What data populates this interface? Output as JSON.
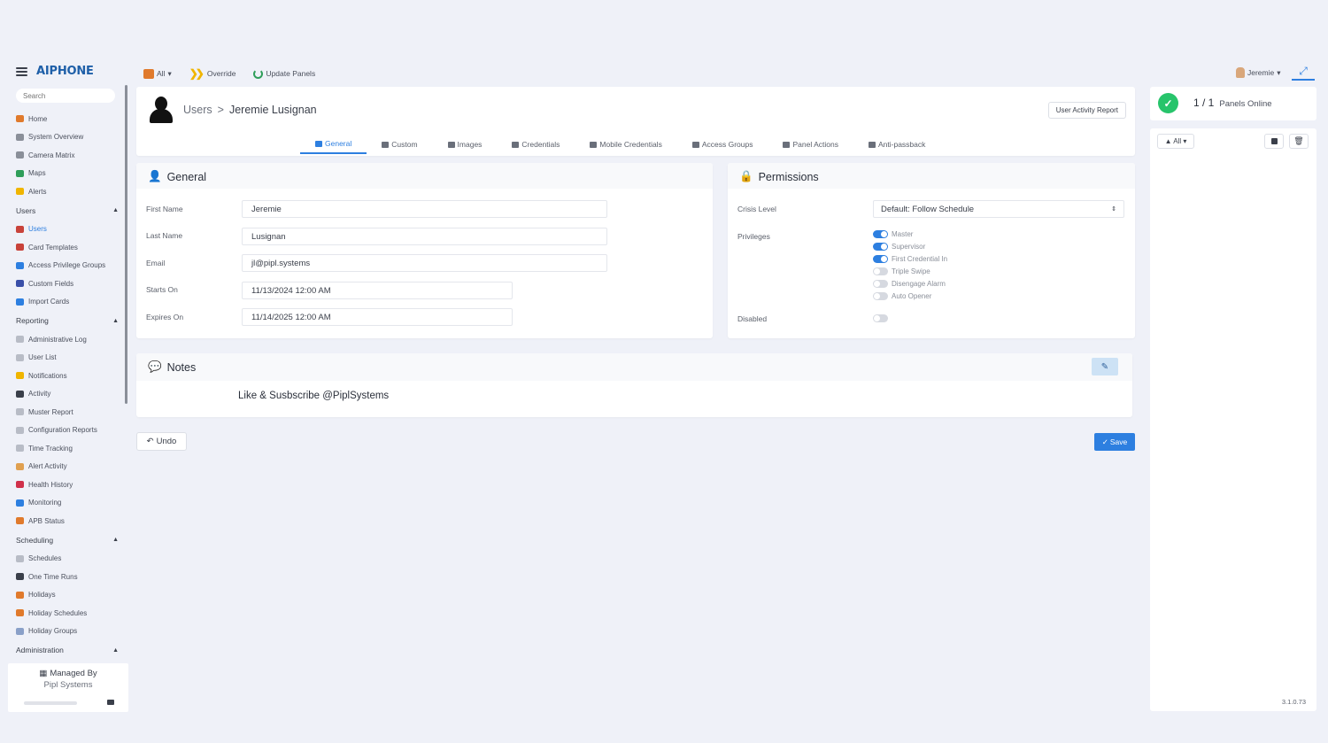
{
  "sidebar": {
    "logo": "AIPHONE",
    "search_placeholder": "Search",
    "items": [
      {
        "label": "Home",
        "color": "#e07a2c"
      },
      {
        "label": "System Overview",
        "color": "#8a8f99"
      },
      {
        "label": "Camera Matrix",
        "color": "#8a8f99"
      },
      {
        "label": "Maps",
        "color": "#2f9e5a"
      },
      {
        "label": "Alerts",
        "color": "#f0b500"
      }
    ],
    "sections": {
      "users": {
        "label": "Users",
        "items": [
          {
            "label": "Users",
            "color": "#c8423a",
            "active": true
          },
          {
            "label": "Card Templates",
            "color": "#c8423a"
          },
          {
            "label": "Access Privilege Groups",
            "color": "#2d7fe0"
          },
          {
            "label": "Custom Fields",
            "color": "#3a4fa8"
          },
          {
            "label": "Import Cards",
            "color": "#2d7fe0"
          }
        ]
      },
      "reporting": {
        "label": "Reporting",
        "items": [
          {
            "label": "Administrative Log",
            "color": "#b8bcc6"
          },
          {
            "label": "User List",
            "color": "#b8bcc6"
          },
          {
            "label": "Notifications",
            "color": "#f0b500"
          },
          {
            "label": "Activity",
            "color": "#3a3f4a"
          },
          {
            "label": "Muster Report",
            "color": "#b8bcc6"
          },
          {
            "label": "Configuration Reports",
            "color": "#b8bcc6"
          },
          {
            "label": "Time Tracking",
            "color": "#b8bcc6"
          },
          {
            "label": "Alert Activity",
            "color": "#e0a050"
          },
          {
            "label": "Health History",
            "color": "#d0304a"
          },
          {
            "label": "Monitoring",
            "color": "#2d7fe0"
          },
          {
            "label": "APB Status",
            "color": "#e07a2c"
          }
        ]
      },
      "scheduling": {
        "label": "Scheduling",
        "items": [
          {
            "label": "Schedules",
            "color": "#b8bcc6"
          },
          {
            "label": "One Time Runs",
            "color": "#3a3f4a"
          },
          {
            "label": "Holidays",
            "color": "#e07a2c"
          },
          {
            "label": "Holiday Schedules",
            "color": "#e07a2c"
          },
          {
            "label": "Holiday Groups",
            "color": "#8aa0c8"
          }
        ]
      },
      "administration": {
        "label": "Administration"
      }
    },
    "managed_by_label": "Managed By",
    "managed_by_name": "Pipl Systems"
  },
  "toolbar": {
    "all_label": "All",
    "override_label": "Override",
    "update_label": "Update Panels",
    "user_label": "Jeremie"
  },
  "header": {
    "breadcrumb_root": "Users",
    "breadcrumb_sep": ">",
    "breadcrumb_current": "Jeremie Lusignan",
    "report_button": "User Activity Report"
  },
  "tabs": [
    {
      "label": "General",
      "active": true
    },
    {
      "label": "Custom"
    },
    {
      "label": "Images"
    },
    {
      "label": "Credentials"
    },
    {
      "label": "Mobile Credentials"
    },
    {
      "label": "Access Groups"
    },
    {
      "label": "Panel Actions"
    },
    {
      "label": "Anti-passback"
    }
  ],
  "general": {
    "title": "General",
    "fields": [
      {
        "label": "First Name",
        "value": "Jeremie"
      },
      {
        "label": "Last Name",
        "value": "Lusignan"
      },
      {
        "label": "Email",
        "value": "jl@pipl.systems"
      },
      {
        "label": "Starts On",
        "value": "11/13/2024 12:00 AM"
      },
      {
        "label": "Expires On",
        "value": "11/14/2025 12:00 AM"
      }
    ]
  },
  "permissions": {
    "title": "Permissions",
    "crisis_label": "Crisis Level",
    "crisis_value": "Default: Follow Schedule",
    "privileges_label": "Privileges",
    "privileges": [
      {
        "label": "Master",
        "on": true
      },
      {
        "label": "Supervisor",
        "on": true
      },
      {
        "label": "First Credential In",
        "on": true
      },
      {
        "label": "Triple Swipe",
        "on": false
      },
      {
        "label": "Disengage Alarm",
        "on": false
      },
      {
        "label": "Auto Opener",
        "on": false
      }
    ],
    "disabled_label": "Disabled"
  },
  "notes": {
    "title": "Notes",
    "text": "Like & Susbscribe @PiplSystems"
  },
  "actions": {
    "undo_label": "Undo",
    "save_label": "Save"
  },
  "panels": {
    "count": "1 / 1",
    "label": "Panels Online",
    "filter_label": "All",
    "version": "3.1.0.73"
  }
}
